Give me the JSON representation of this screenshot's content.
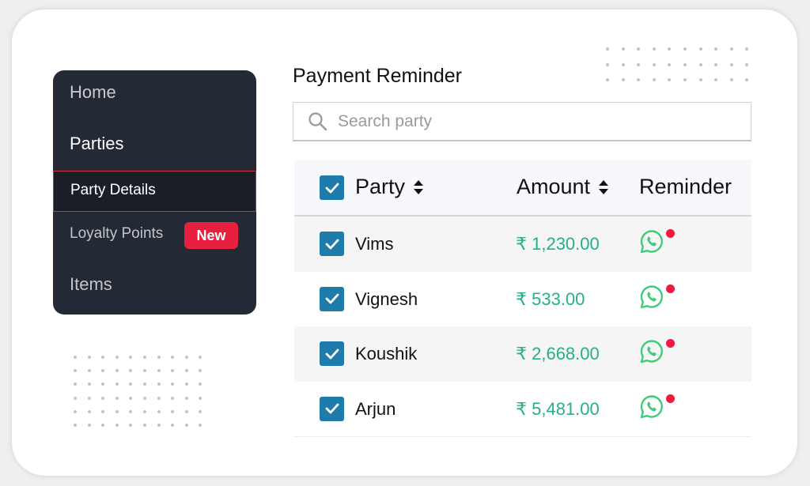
{
  "sidebar": {
    "items": [
      {
        "label": "Home",
        "state": "default"
      },
      {
        "label": "Parties",
        "state": "section"
      },
      {
        "label": "Party Details",
        "state": "selected"
      },
      {
        "label": "Loyalty Points",
        "state": "default",
        "badge": "New"
      },
      {
        "label": "Items",
        "state": "default"
      }
    ]
  },
  "main": {
    "title": "Payment Reminder",
    "search": {
      "placeholder": "Search party",
      "value": ""
    },
    "table": {
      "select_all_checked": true,
      "columns": [
        {
          "label": "Party",
          "sortable": true
        },
        {
          "label": "Amount",
          "sortable": true
        },
        {
          "label": "Reminder",
          "sortable": false
        }
      ],
      "rows": [
        {
          "checked": true,
          "party": "Vims",
          "amount": "₹ 1,230.00",
          "reminder_icon": "whatsapp-icon",
          "notification": true
        },
        {
          "checked": true,
          "party": "Vignesh",
          "amount": "₹ 533.00",
          "reminder_icon": "whatsapp-icon",
          "notification": true
        },
        {
          "checked": true,
          "party": "Koushik",
          "amount": "₹ 2,668.00",
          "reminder_icon": "whatsapp-icon",
          "notification": true
        },
        {
          "checked": true,
          "party": "Arjun",
          "amount": "₹ 5,481.00",
          "reminder_icon": "whatsapp-icon",
          "notification": true
        }
      ]
    }
  },
  "colors": {
    "sidebar_bg": "#232a35",
    "selected_border": "#d92b3a",
    "badge_bg": "#e8203f",
    "checkbox": "#1f7bab",
    "amount": "#23b08a",
    "whatsapp": "#3fcc7a",
    "notification_dot": "#ee1b3e"
  }
}
